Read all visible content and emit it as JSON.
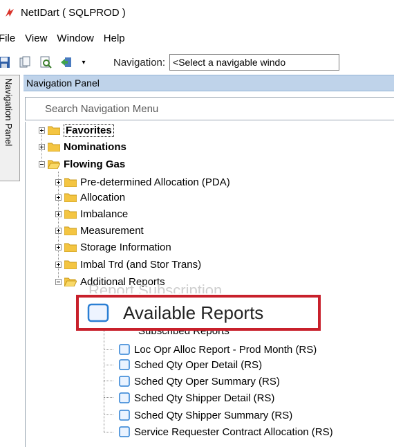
{
  "window": {
    "title": "NetIDart ( SQLPROD )"
  },
  "menu": [
    "File",
    "View",
    "Window",
    "Help"
  ],
  "toolbar": {
    "navigation_label": "Navigation:",
    "navigation_value": "<Select a navigable windo"
  },
  "side_tab": {
    "label": "Navigation Panel"
  },
  "panel": {
    "header": "Navigation Panel",
    "search_placeholder": "Search Navigation Menu"
  },
  "tree": {
    "favorites": "Favorites",
    "nominations": "Nominations",
    "flowing_gas": "Flowing Gas",
    "children": [
      "Pre-determined Allocation (PDA)",
      "Allocation",
      "Imbalance",
      "Measurement",
      "Storage Information",
      "Imbal Trd (and Stor Trans)",
      "Additional Reports"
    ],
    "reports": [
      "Subscribed Reports",
      "Loc Opr Alloc Report - Prod Month (RS)",
      "Sched Qty Oper Detail (RS)",
      "Sched Qty Oper Summary (RS)",
      "Sched Qty Shipper Detail (RS)",
      "Sched Qty Shipper Summary (RS)",
      "Service Requester Contract Allocation (RS)"
    ]
  },
  "callout": {
    "label": "Available Reports",
    "behind_text": "Report Subscription",
    "border_color": "#c8202b"
  },
  "colors": {
    "header_bg": "#bfd3ea",
    "folder": "#f4c542"
  }
}
